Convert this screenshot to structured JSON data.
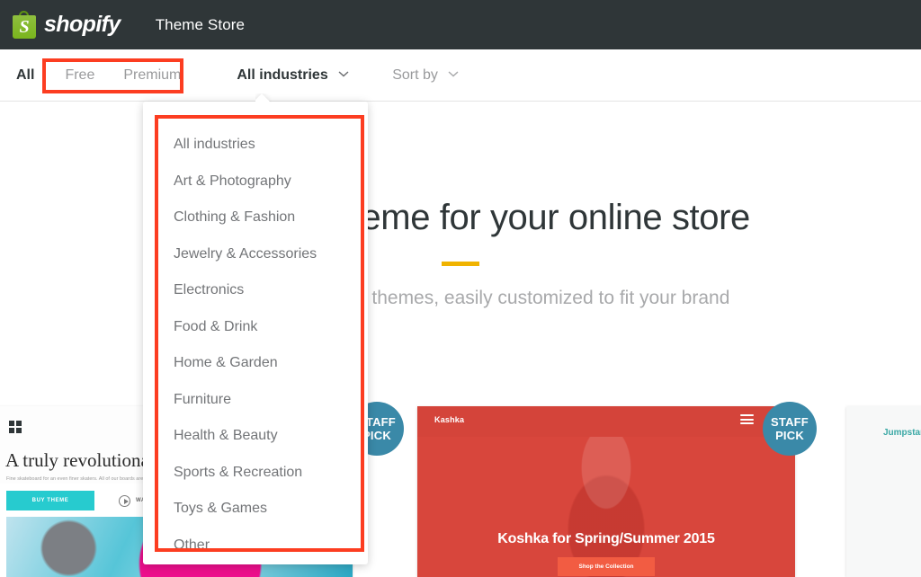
{
  "header": {
    "logo_icon": "shopify-bag-icon",
    "wordmark": "shopify",
    "title": "Theme Store",
    "background_color": "#2f3638"
  },
  "nav": {
    "tabs": [
      {
        "label": "All",
        "active": true
      },
      {
        "label": "Free",
        "active": false
      },
      {
        "label": "Premium",
        "active": false
      }
    ],
    "filters": [
      {
        "label": "All industries",
        "active": true,
        "icon": "chevron-down-icon",
        "expanded": true
      },
      {
        "label": "Sort by",
        "active": false,
        "icon": "chevron-down-icon",
        "expanded": false
      }
    ]
  },
  "dropdown": {
    "name": "all-industries-dropdown",
    "items": [
      "All industries",
      "Art & Photography",
      "Clothing & Fashion",
      "Jewelry & Accessories",
      "Electronics",
      "Food & Drink",
      "Home & Garden",
      "Furniture",
      "Health & Beauty",
      "Sports & Recreation",
      "Toys & Games",
      "Other"
    ]
  },
  "hero": {
    "title": "Choose a theme for your online store",
    "subtitle": "Beautiful, responsive themes, easily customized to fit your brand",
    "rule_color": "#f0b300"
  },
  "cards": [
    {
      "name": "theme-card-board",
      "headline": "A truly revolutionary board",
      "subtext": "Fine skateboard for an even finer skaters. All of our boards are handmade.",
      "primary_button": "BUY THEME",
      "secondary_button": "WATCH THE VIDEO",
      "badge": "STAFF PICK",
      "accent_color": "#27cbcf"
    },
    {
      "name": "theme-card-kashka",
      "brand": "Kashka",
      "tagline": "Koshka for Spring/Summer 2015",
      "cta": "Shop the Collection",
      "badge": "STAFF PICK",
      "accent_color": "#d8463c"
    },
    {
      "name": "theme-card-jumpstart",
      "brand": "Jumpstart",
      "accent_color": "#3aa8a5"
    }
  ],
  "badges": {
    "staff_pick_line1": "STAFF",
    "staff_pick_line2": "PICK",
    "color": "#3a89a8"
  },
  "annotations": {
    "highlight_color": "#fc3d21"
  }
}
